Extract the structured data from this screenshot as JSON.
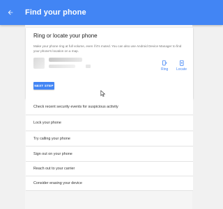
{
  "appbar": {
    "title": "Find your phone",
    "back_icon": "arrow-back-icon"
  },
  "ring_card": {
    "heading": "Ring or locate your phone",
    "description": "Make your phone ring at full volume, even if it's muted. You can also use Android Device Manager to find your phone's location on a map.",
    "actions": [
      {
        "label": "Ring",
        "icon": "phone-ring-icon"
      },
      {
        "label": "Locate",
        "icon": "locate-icon"
      }
    ],
    "next_button": "NEXT STEP"
  },
  "options": [
    "Check recent security events for suspicious activity",
    "Lock your phone",
    "Try calling your phone",
    "Sign out on your phone",
    "Reach out to your carrier",
    "Consider erasing your device"
  ],
  "colors": {
    "accent": "#4285f4",
    "background": "#f1f1f1",
    "card": "#ffffff"
  }
}
